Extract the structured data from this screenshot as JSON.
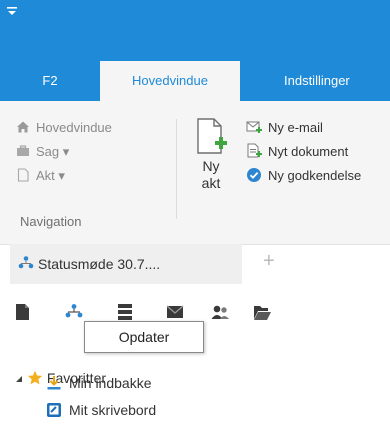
{
  "window": {
    "accent": "#1e8ad8"
  },
  "ribbon_tabs": [
    {
      "label": "F2",
      "active": false
    },
    {
      "label": "Hovedvindue",
      "active": true
    },
    {
      "label": "Indstillinger",
      "active": false
    }
  ],
  "navigation": {
    "items": [
      {
        "label": "Hovedvindue",
        "icon": "home-icon"
      },
      {
        "label": "Sag ▾",
        "icon": "case-icon"
      },
      {
        "label": "Akt ▾",
        "icon": "document-icon"
      }
    ],
    "group_label": "Navigation"
  },
  "new_act": {
    "label_line1": "Ny",
    "label_line2": "akt"
  },
  "commands": [
    {
      "label": "Ny e-mail",
      "icon": "email-add-icon"
    },
    {
      "label": "Nyt dokument",
      "icon": "document-add-icon"
    },
    {
      "label": "Ny godkendelse",
      "icon": "approval-icon"
    }
  ],
  "doc_tabs": {
    "active_label": "Statusmøde 30.7....",
    "add_label": "+"
  },
  "tooltip": {
    "text": "Opdater"
  },
  "tree": {
    "favorites_label": "Favoritter",
    "items": [
      {
        "label": "Min indbakke",
        "icon": "inbox-icon"
      },
      {
        "label": "Mit skrivebord",
        "icon": "desk-icon"
      }
    ]
  }
}
